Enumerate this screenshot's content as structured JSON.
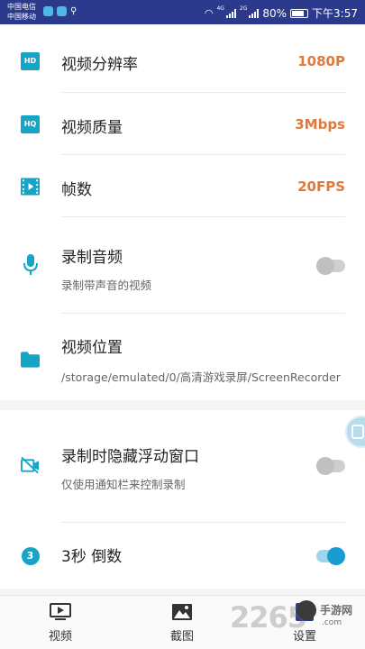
{
  "statusbar": {
    "carrier1": "中国电信",
    "carrier2": "中国移动",
    "net1": "4G",
    "net2": "2G",
    "battery": "80%",
    "time": "下午3:57"
  },
  "settings": {
    "resolution": {
      "icon": "hd-icon",
      "badge": "HD",
      "label": "视频分辨率",
      "value": "1080P"
    },
    "quality": {
      "icon": "hq-icon",
      "badge": "HQ",
      "label": "视频质量",
      "value": "3Mbps"
    },
    "framerate": {
      "icon": "film-icon",
      "label": "帧数",
      "value": "20FPS"
    },
    "audio": {
      "icon": "microphone-icon",
      "label": "录制音频",
      "sub": "录制带声音的视频",
      "enabled": false
    },
    "location": {
      "icon": "folder-icon",
      "label": "视频位置",
      "sub": "/storage/emulated/0/高清游戏录屏/ScreenRecorder"
    },
    "hide_float": {
      "icon": "camera-off-icon",
      "label": "录制时隐藏浮动窗口",
      "sub": "仅使用通知栏来控制录制",
      "enabled": false
    },
    "countdown": {
      "icon": "countdown-icon",
      "badge": "3",
      "label": "3秒 倒数",
      "enabled": true
    }
  },
  "nav": {
    "tabs": [
      {
        "icon": "video-icon",
        "label": "视频"
      },
      {
        "icon": "image-icon",
        "label": "截图"
      },
      {
        "icon": "settings-icon",
        "label": "设置"
      }
    ]
  },
  "watermark": {
    "num": "2265",
    "site": "手游网",
    "url": ".com"
  },
  "colors": {
    "accent": "#16a5c4",
    "value": "#e07a3a",
    "statusbar": "#2b3a8c",
    "toggle_on": "#1a9bd1"
  }
}
